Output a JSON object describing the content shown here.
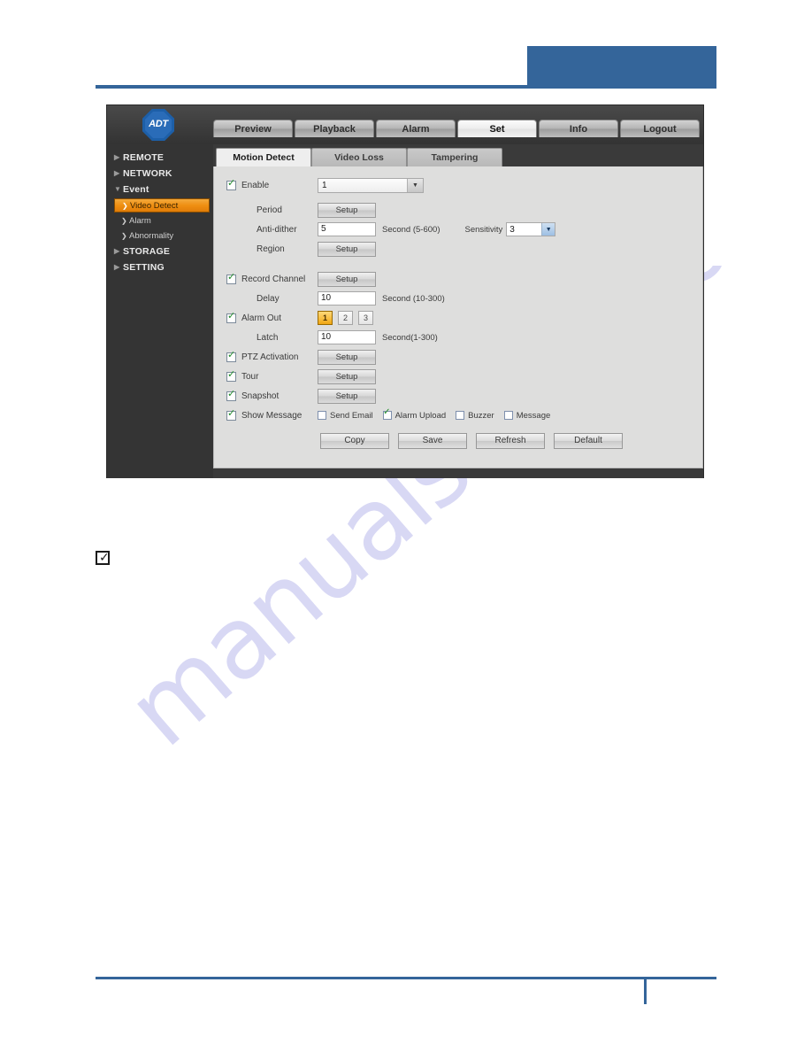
{
  "watermark": {
    "text": "manualshive.com"
  },
  "note_marker": {
    "glyph": "✓"
  },
  "screenshot": {
    "logo": {
      "text": "ADT"
    },
    "main_tabs": [
      {
        "label": "Preview",
        "selected": false
      },
      {
        "label": "Playback",
        "selected": false
      },
      {
        "label": "Alarm",
        "selected": false
      },
      {
        "label": "Set",
        "selected": true
      },
      {
        "label": "Info",
        "selected": false
      },
      {
        "label": "Logout",
        "selected": false
      }
    ],
    "sidebar": [
      {
        "label": "REMOTE",
        "level": "top",
        "arrow": "▶",
        "selected": false
      },
      {
        "label": "NETWORK",
        "level": "top",
        "arrow": "▶",
        "selected": false
      },
      {
        "label": "Event",
        "level": "top",
        "arrow": "▼",
        "selected": false
      },
      {
        "label": "Video Detect",
        "level": "sub",
        "arrow": "❯",
        "selected": true
      },
      {
        "label": "Alarm",
        "level": "sub",
        "arrow": "❯",
        "selected": false
      },
      {
        "label": "Abnormality",
        "level": "sub",
        "arrow": "❯",
        "selected": false
      },
      {
        "label": "STORAGE",
        "level": "top",
        "arrow": "▶",
        "selected": false
      },
      {
        "label": "SETTING",
        "level": "top",
        "arrow": "▶",
        "selected": false
      }
    ],
    "sub_tabs": [
      {
        "label": "Motion Detect",
        "selected": true
      },
      {
        "label": "Video Loss",
        "selected": false
      },
      {
        "label": "Tampering",
        "selected": false
      }
    ],
    "form": {
      "enable": {
        "label": "Enable",
        "checked": true,
        "channel_value": "1",
        "arrow": "▼"
      },
      "period": {
        "label": "Period",
        "button": "Setup"
      },
      "anti_dither": {
        "label": "Anti-dither",
        "value": "5",
        "unit": "Second (5-600)"
      },
      "sensitivity": {
        "label": "Sensitivity",
        "value": "3",
        "arrow": "▼"
      },
      "region": {
        "label": "Region",
        "button": "Setup"
      },
      "record_channel": {
        "label": "Record Channel",
        "checked": true,
        "button": "Setup"
      },
      "delay": {
        "label": "Delay",
        "value": "10",
        "unit": "Second (10-300)"
      },
      "alarm_out": {
        "label": "Alarm Out",
        "checked": true,
        "channels": [
          {
            "label": "1",
            "active": true
          },
          {
            "label": "2",
            "active": false
          },
          {
            "label": "3",
            "active": false
          }
        ]
      },
      "latch": {
        "label": "Latch",
        "value": "10",
        "unit": "Second(1-300)"
      },
      "ptz_activation": {
        "label": "PTZ Activation",
        "checked": true,
        "button": "Setup"
      },
      "tour": {
        "label": "Tour",
        "checked": true,
        "button": "Setup"
      },
      "snapshot": {
        "label": "Snapshot",
        "checked": true,
        "button": "Setup"
      },
      "show_message": {
        "label": "Show Message",
        "checked": true,
        "options": [
          {
            "label": "Send Email",
            "checked": false
          },
          {
            "label": "Alarm Upload",
            "checked": true
          },
          {
            "label": "Buzzer",
            "checked": false
          },
          {
            "label": "Message",
            "checked": false
          }
        ]
      },
      "actions": [
        {
          "label": "Copy"
        },
        {
          "label": "Save"
        },
        {
          "label": "Refresh"
        },
        {
          "label": "Default"
        }
      ]
    }
  },
  "colors": {
    "accent_blue": "#34659a",
    "highlight_orange": "#ef8f12",
    "panel_grey": "#dededd",
    "chrome_dark": "#343434",
    "watermark": "#d8d8f4"
  }
}
